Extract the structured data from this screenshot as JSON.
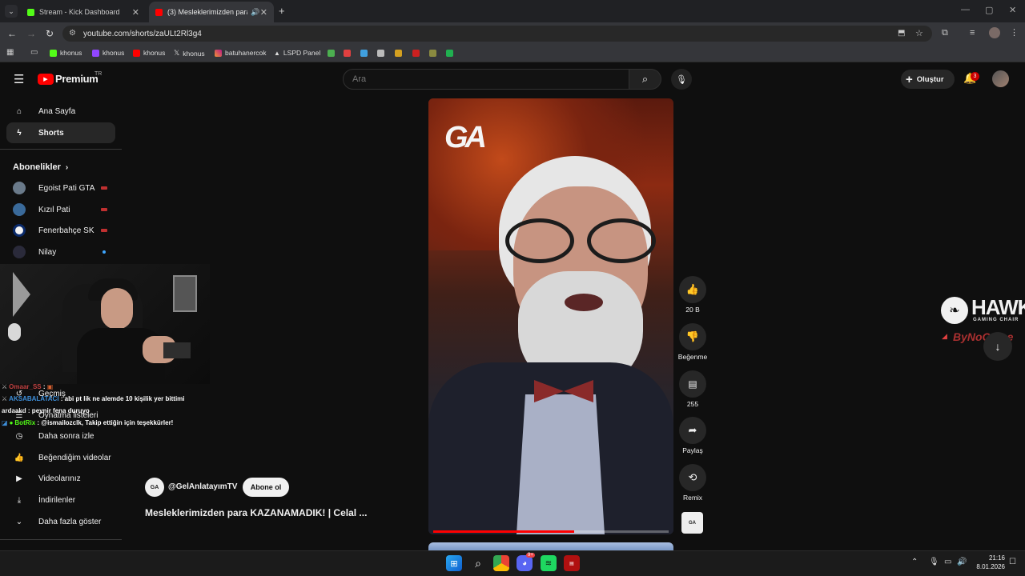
{
  "browser": {
    "tabs": [
      {
        "title": "Stream - Kick Dashboard"
      },
      {
        "title": "(3) Mesleklerimizden para K"
      }
    ],
    "url": "youtube.com/shorts/zaULt2Rl3g4",
    "bookmarks": [
      "khonus",
      "khonus",
      "khonus",
      "khonus",
      "batuhanercok",
      "LSPD Panel"
    ]
  },
  "youtube": {
    "logo_text": "Premium",
    "region": "TR",
    "search_placeholder": "Ara",
    "create_label": "Oluştur",
    "notification_count": "3"
  },
  "sidebar": {
    "nav": [
      {
        "label": "Ana Sayfa"
      },
      {
        "label": "Shorts"
      }
    ],
    "subscriptions_title": "Abonelikler",
    "subscriptions": [
      {
        "label": "Egoist Pati GTA"
      },
      {
        "label": "Kızıl Pati"
      },
      {
        "label": "Fenerbahçe SK"
      },
      {
        "label": "Nilay"
      }
    ],
    "library": [
      {
        "label": "Geçmiş"
      },
      {
        "label": "Oynatma listeleri"
      },
      {
        "label": "Daha sonra izle"
      },
      {
        "label": "Beğendiğim videolar"
      },
      {
        "label": "Videolarınız"
      },
      {
        "label": "İndirilenler"
      },
      {
        "label": "Daha fazla göster"
      }
    ]
  },
  "short": {
    "channel_logo_text": "GA",
    "channel_handle": "@GelAnlatayımTV",
    "subscribe_label": "Abone ol",
    "title": "Mesleklerimizden para KAZANAMADIK! | Celal ...",
    "progress": 0.6,
    "actions": {
      "like_count": "20 B",
      "dislike_label": "Beğenme",
      "comments_count": "255",
      "share_label": "Paylaş",
      "remix_label": "Remix"
    }
  },
  "overlay": {
    "chat": [
      {
        "user": "Omaar_SS",
        "text": ":"
      },
      {
        "user": "AKSABALATACI",
        "text": ": abi pt lik ne alemde 10 kişilik yer bittimi"
      },
      {
        "user": "ardaakd",
        "text": ": peynir fena duruyo"
      },
      {
        "user": "BotRix",
        "text": ": @ismailozclk, Takip ettiğin için teşekkürler!"
      }
    ],
    "sponsor_brand": "HAWK",
    "sponsor_sub": "GAMING CHAIR",
    "sponsor_tag": "ByNoGame"
  },
  "taskbar": {
    "discord_badge": "9+",
    "time": "21:16",
    "date": "8.01.2026"
  },
  "colors": {
    "accent_red": "#ff0000",
    "kick_green": "#53fc18",
    "page_bg": "#0f0f0f"
  }
}
